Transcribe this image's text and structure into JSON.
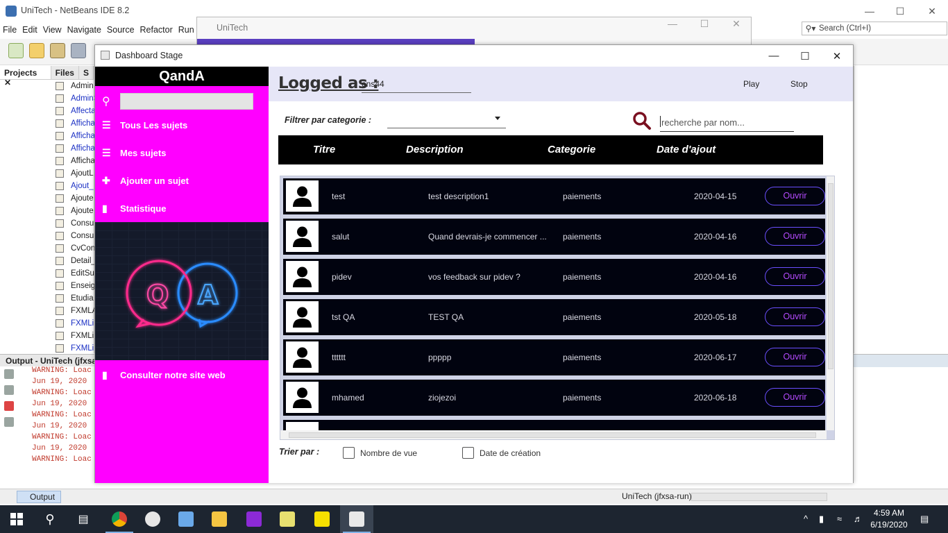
{
  "netbeans": {
    "title": "UniTech - NetBeans IDE 8.2",
    "menu": [
      "File",
      "Edit",
      "View",
      "Navigate",
      "Source",
      "Refactor",
      "Run",
      "D"
    ],
    "search_placeholder": "Search (Ctrl+I)",
    "tabs": [
      "Projects",
      "Files",
      "S"
    ],
    "tree": [
      {
        "label": "Admin",
        "link": false
      },
      {
        "label": "AdminS",
        "link": true
      },
      {
        "label": "Affecta",
        "link": true
      },
      {
        "label": "Afficha",
        "link": true
      },
      {
        "label": "Afficha",
        "link": true
      },
      {
        "label": "Afficha",
        "link": true
      },
      {
        "label": "Afficha",
        "link": false
      },
      {
        "label": "AjoutL",
        "link": false
      },
      {
        "label": "Ajout_",
        "link": true
      },
      {
        "label": "Ajoute",
        "link": false
      },
      {
        "label": "Ajoute",
        "link": false
      },
      {
        "label": "Consu",
        "link": false
      },
      {
        "label": "Consu",
        "link": false
      },
      {
        "label": "CvCon",
        "link": false
      },
      {
        "label": "Detail_",
        "link": false
      },
      {
        "label": "EditSu",
        "link": false
      },
      {
        "label": "Enseig",
        "link": false
      },
      {
        "label": "Etudia",
        "link": false
      },
      {
        "label": "FXMLA",
        "link": false
      },
      {
        "label": "FXMLin",
        "link": true
      },
      {
        "label": "FXMLin",
        "link": false
      },
      {
        "label": "FXMLin",
        "link": true
      }
    ],
    "output_title": "Output - UniTech (jfxsa",
    "output_lines": [
      "WARNING: Loac",
      "Jun 19, 2020",
      "WARNING: Loac",
      "Jun 19, 2020",
      "WARNING: Loac",
      "Jun 19, 2020",
      "WARNING: Loac",
      "Jun 19, 2020",
      "WARNING: Loac"
    ],
    "status_output_tab": "Output",
    "status_run": "UniTech (jfxsa-run)"
  },
  "unitech_window": {
    "title": "UniTech"
  },
  "stage": {
    "title": "Dashboard Stage",
    "brand": "QandA",
    "nav": [
      {
        "label": "Tous Les sujets",
        "icon": "list-icon"
      },
      {
        "label": "Mes sujets",
        "icon": "list-icon"
      },
      {
        "label": "Ajouter un sujet",
        "icon": "add-user-icon"
      },
      {
        "label": "Statistique",
        "icon": "signal-icon"
      }
    ],
    "site_link": "Consulter notre site web",
    "header": {
      "logged_label": "Logged as :",
      "username": "ens44",
      "play": "Play",
      "stop": "Stop"
    },
    "filter_label": "Filtrer par categorie :",
    "filter_value": "",
    "search_placeholder": "recherche par nom...",
    "columns": [
      "Titre",
      "Description",
      "Categorie",
      "Date d'ajout"
    ],
    "open_label": "Ouvrir",
    "rows": [
      {
        "title": "test",
        "description": "test description1",
        "category": "paiements",
        "date": "2020-04-15"
      },
      {
        "title": "salut",
        "description": "Quand devrais-je commencer ...",
        "category": "paiements",
        "date": "2020-04-16"
      },
      {
        "title": "pidev",
        "description": "vos feedback sur pidev ?",
        "category": "paiements",
        "date": "2020-04-16"
      },
      {
        "title": "tst QA",
        "description": "TEST QA",
        "category": "paiements",
        "date": "2020-05-18"
      },
      {
        "title": "tttttt",
        "description": "ppppp",
        "category": "paiements",
        "date": "2020-06-17"
      },
      {
        "title": "mhamed",
        "description": "ziojezoi",
        "category": "paiements",
        "date": "2020-06-18"
      }
    ],
    "sort_label": "Trier par :",
    "sort_options": [
      "Nombre de vue",
      "Date de création"
    ]
  },
  "taskbar": {
    "time": "4:59 AM",
    "date": "6/19/2020"
  },
  "colors": {
    "sidebar": "#ff00ff",
    "row_bg": "#01030f",
    "open_button": "#6b4fff",
    "header_bg": "#e6e6f7"
  }
}
